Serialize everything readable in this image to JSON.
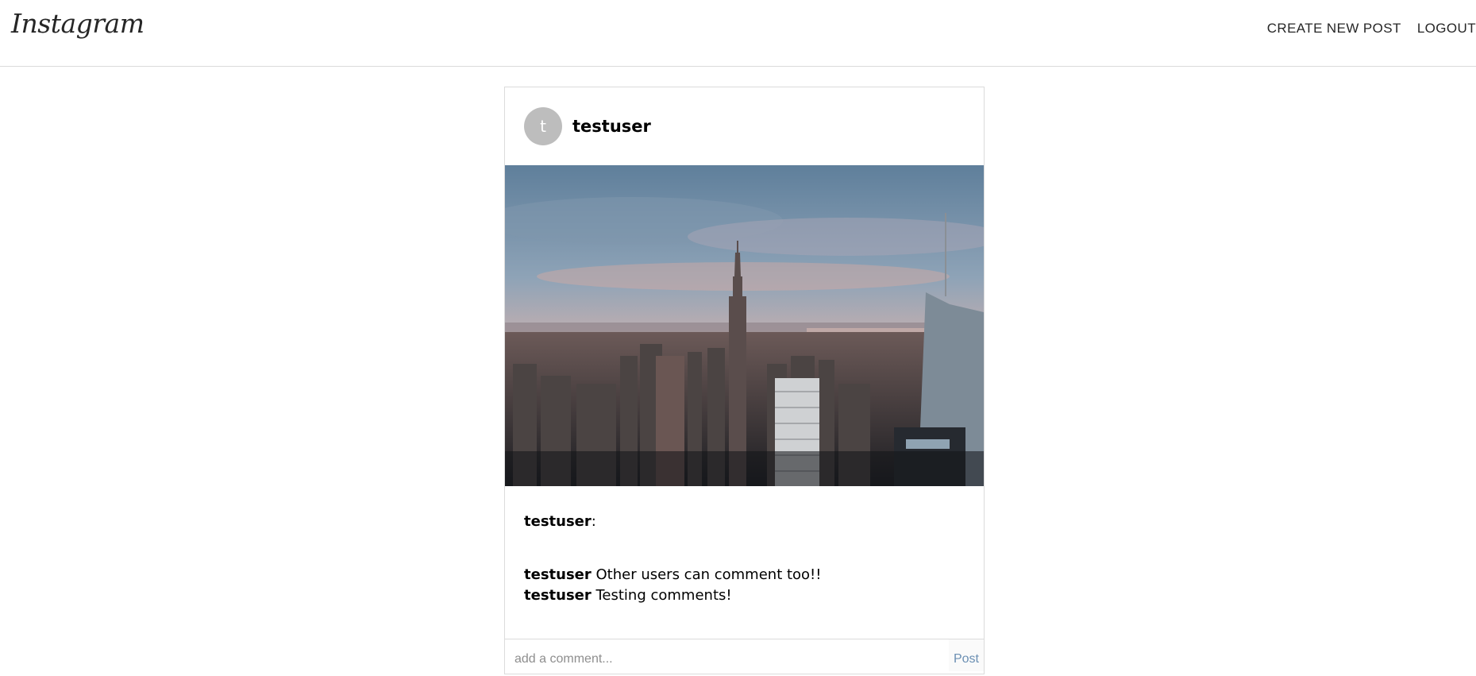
{
  "header": {
    "logo": "Instagram",
    "nav": {
      "create_post": "CREATE NEW POST",
      "logout": "LOGOUT"
    }
  },
  "post": {
    "avatar_letter": "t",
    "username": "testuser",
    "image_alt": "city skyline at sunset",
    "caption": {
      "username": "testuser",
      "separator": ":",
      "text": ""
    },
    "comments": [
      {
        "username": "testuser",
        "text": "Other users can comment too!!"
      },
      {
        "username": "testuser",
        "text": "Testing comments!"
      }
    ],
    "comment_form": {
      "placeholder": "add a comment...",
      "button_label": "Post"
    }
  },
  "colors": {
    "border": "#dbdbdb",
    "avatar_bg": "#bdbdbd",
    "post_button_text": "#6b8fb3"
  }
}
